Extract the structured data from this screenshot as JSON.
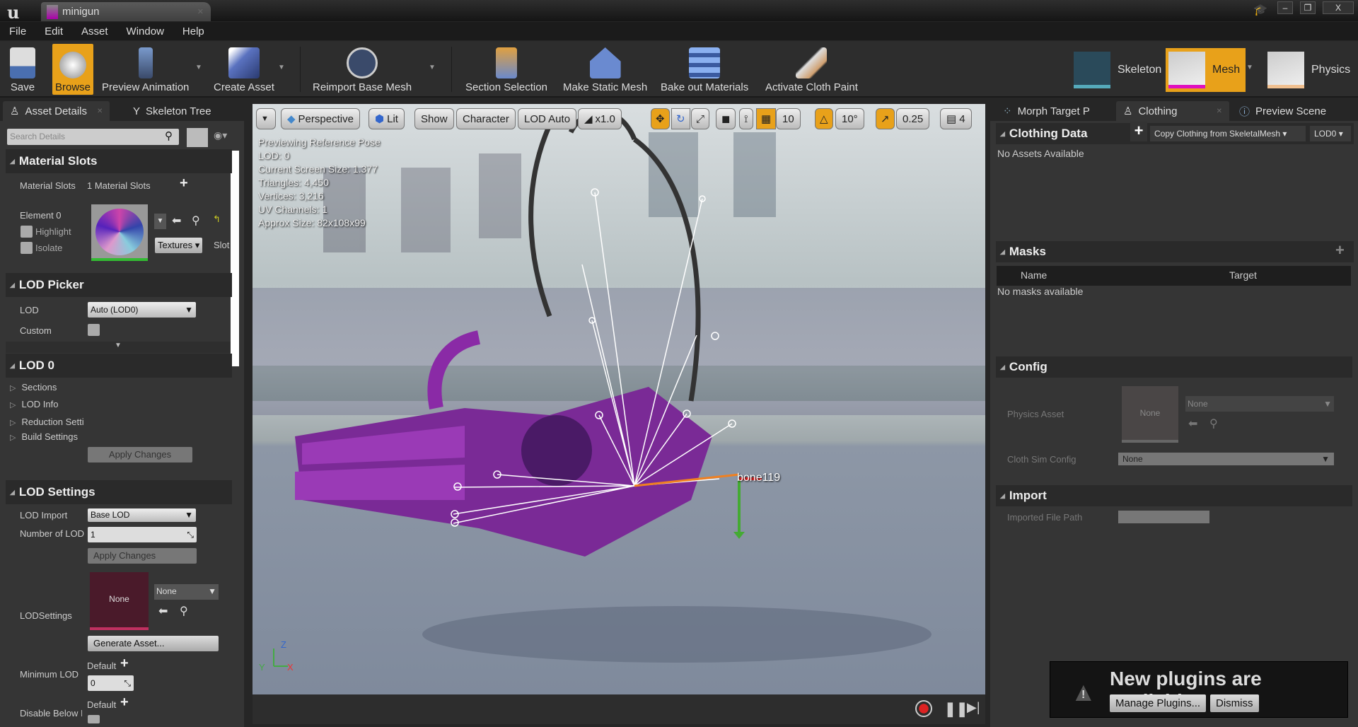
{
  "window": {
    "tab_title": "minigun",
    "min": "‒",
    "restore": "❐",
    "close": "X"
  },
  "menu": [
    "File",
    "Edit",
    "Asset",
    "Window",
    "Help"
  ],
  "toolbar": {
    "save": "Save",
    "browse": "Browse",
    "preview_animation": "Preview Animation",
    "create_asset": "Create Asset",
    "reimport": "Reimport Base Mesh",
    "section_selection": "Section Selection",
    "make_static_mesh": "Make Static Mesh",
    "bake_out": "Bake out Materials",
    "cloth_paint": "Activate Cloth Paint"
  },
  "modes": {
    "skeleton": "Skeleton",
    "mesh": "Mesh",
    "physics": "Physics"
  },
  "left_tabs": [
    "Asset Details",
    "Skeleton Tree"
  ],
  "details": {
    "search_placeholder": "Search Details",
    "material_slots": {
      "title": "Material Slots",
      "label": "Material Slots",
      "value": "1 Material Slots",
      "element": "Element 0",
      "highlight": "Highlight",
      "isolate": "Isolate",
      "textures": "Textures",
      "slot": "Slot"
    },
    "lod_picker": {
      "title": "LOD Picker",
      "lod_label": "LOD",
      "lod_value": "Auto (LOD0)",
      "custom": "Custom"
    },
    "lod0": {
      "title": "LOD 0",
      "items": [
        "Sections",
        "LOD Info",
        "Reduction Setti",
        "Build Settings"
      ],
      "apply": "Apply Changes"
    },
    "lod_settings": {
      "title": "LOD Settings",
      "lod_import": "LOD Import",
      "lod_import_value": "Base LOD",
      "num_lod": "Number of LOD",
      "num_lod_value": "1",
      "apply": "Apply Changes",
      "lodsettings": "LODSettings",
      "thumb": "None",
      "none": "None",
      "generate": "Generate Asset...",
      "min_lod": "Minimum LOD",
      "default": "Default",
      "min_lod_value": "0",
      "disable_below": "Disable Below I",
      "default2": "Default"
    }
  },
  "viewport": {
    "perspective": "Perspective",
    "lit": "Lit",
    "show": "Show",
    "character": "Character",
    "lod": "LOD Auto",
    "speed": "x1.0",
    "grid": "10",
    "angle": "10°",
    "scale": "0.25",
    "cam": "4",
    "stats": [
      "Previewing Reference Pose",
      "LOD: 0",
      "Current Screen Size: 1.377",
      "Triangles: 4,450",
      "Vertices: 3,216",
      "UV Channels: 1",
      "Approx Size: 82x108x99"
    ],
    "bone_label": "bone119",
    "axis_z": "Z",
    "axis_x": "X",
    "axis_y": "Y"
  },
  "right_tabs": [
    "Morph Target P",
    "Clothing",
    "Preview Scene"
  ],
  "clothing": {
    "title": "Clothing Data",
    "copy": "Copy Clothing from SkeletalMesh",
    "lod": "LOD0",
    "empty": "No Assets Available"
  },
  "masks": {
    "title": "Masks",
    "col_name": "Name",
    "col_target": "Target",
    "empty": "No masks available"
  },
  "config": {
    "title": "Config",
    "physics_asset": "Physics Asset",
    "thumb": "None",
    "combo": "None",
    "cloth_sim": "Cloth Sim Config",
    "cloth_sim_value": "None"
  },
  "import": {
    "title": "Import",
    "path_label": "Imported File Path"
  },
  "notification": {
    "title": "New plugins are available",
    "manage": "Manage Plugins...",
    "dismiss": "Dismiss"
  },
  "colors": {
    "accent": "#e8a11a",
    "mesh": "#8a2a9a"
  }
}
